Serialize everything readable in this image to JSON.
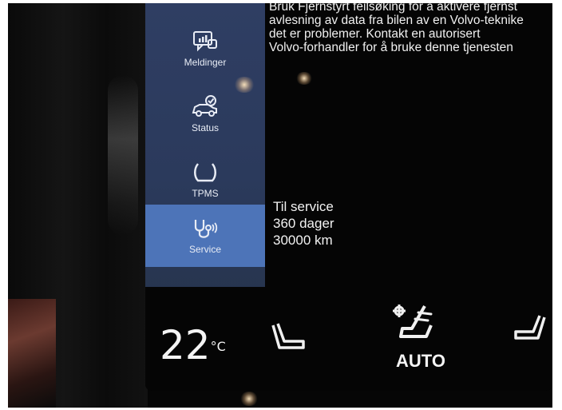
{
  "sidebar": {
    "items": [
      {
        "label": "Meldinger",
        "icon": "messages-icon"
      },
      {
        "label": "Status",
        "icon": "car-status-icon"
      },
      {
        "label": "TPMS",
        "icon": "tire-pressure-icon"
      },
      {
        "label": "Service",
        "icon": "stethoscope-icon",
        "active": true
      }
    ]
  },
  "main": {
    "info_lines": [
      "Bruk Fjernstyrt feilsøking for å aktivere fjernst",
      "avlesning av data fra bilen av en Volvo-teknike",
      "det er problemer. Kontakt en autorisert",
      "Volvo-forhandler for å bruke denne tjenesten"
    ],
    "service": {
      "title": "Til service",
      "days": "360 dager",
      "distance": "30000 km"
    }
  },
  "climate": {
    "temperature": "22",
    "unit": "°C",
    "auto_label": "AUTO"
  },
  "colors": {
    "sidebar_bg": "#2f3e63",
    "active_item": "#4d74b8",
    "text": "#f0f0f0"
  }
}
